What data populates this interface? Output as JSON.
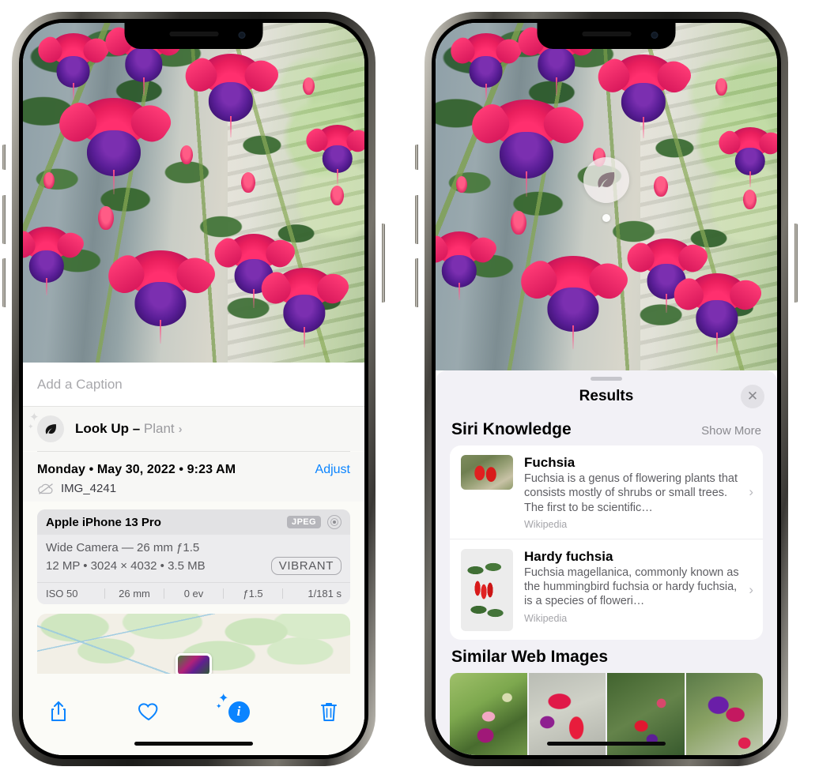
{
  "left_phone": {
    "caption": {
      "placeholder": "Add a Caption"
    },
    "lookup": {
      "label": "Look Up – ",
      "subject": "Plant",
      "chevron": "›",
      "icon": "leaf-icon"
    },
    "meta": {
      "date": "Monday • May 30, 2022 • 9:23 AM",
      "adjust": "Adjust",
      "filename": "IMG_4241",
      "cloud_icon": "cloud-slash-icon"
    },
    "exif": {
      "device": "Apple iPhone 13 Pro",
      "format_badge": "JPEG",
      "aperture_icon": "aperture-icon",
      "lens": "Wide Camera — 26 mm ƒ1.5",
      "specs": "12 MP • 3024 × 4032 • 3.5 MB",
      "style_badge": "VIBRANT",
      "stats": [
        "ISO 50",
        "26 mm",
        "0 ev",
        "ƒ1.5",
        "1/181 s"
      ]
    },
    "toolbar": {
      "share": "share-icon",
      "favorite": "heart-icon",
      "info": "info-sparkles-icon",
      "info_glyph": "i",
      "delete": "trash-icon",
      "accent_color": "#0a84ff"
    }
  },
  "right_phone": {
    "bubble": {
      "icon": "leaf-icon"
    },
    "header": {
      "title": "Results",
      "close": "✕"
    },
    "siri": {
      "title": "Siri Knowledge",
      "show_more": "Show More",
      "cards": [
        {
          "title": "Fuchsia",
          "description": "Fuchsia is a genus of flowering plants that consists mostly of shrubs or small trees. The first to be scientific…",
          "source": "Wikipedia",
          "chevron": "›"
        },
        {
          "title": "Hardy fuchsia",
          "description": "Fuchsia magellanica, commonly known as the hummingbird fuchsia or hardy fuchsia, is a species of floweri…",
          "source": "Wikipedia",
          "chevron": "›"
        }
      ]
    },
    "web": {
      "title": "Similar Web Images",
      "thumb_count": 4
    }
  }
}
